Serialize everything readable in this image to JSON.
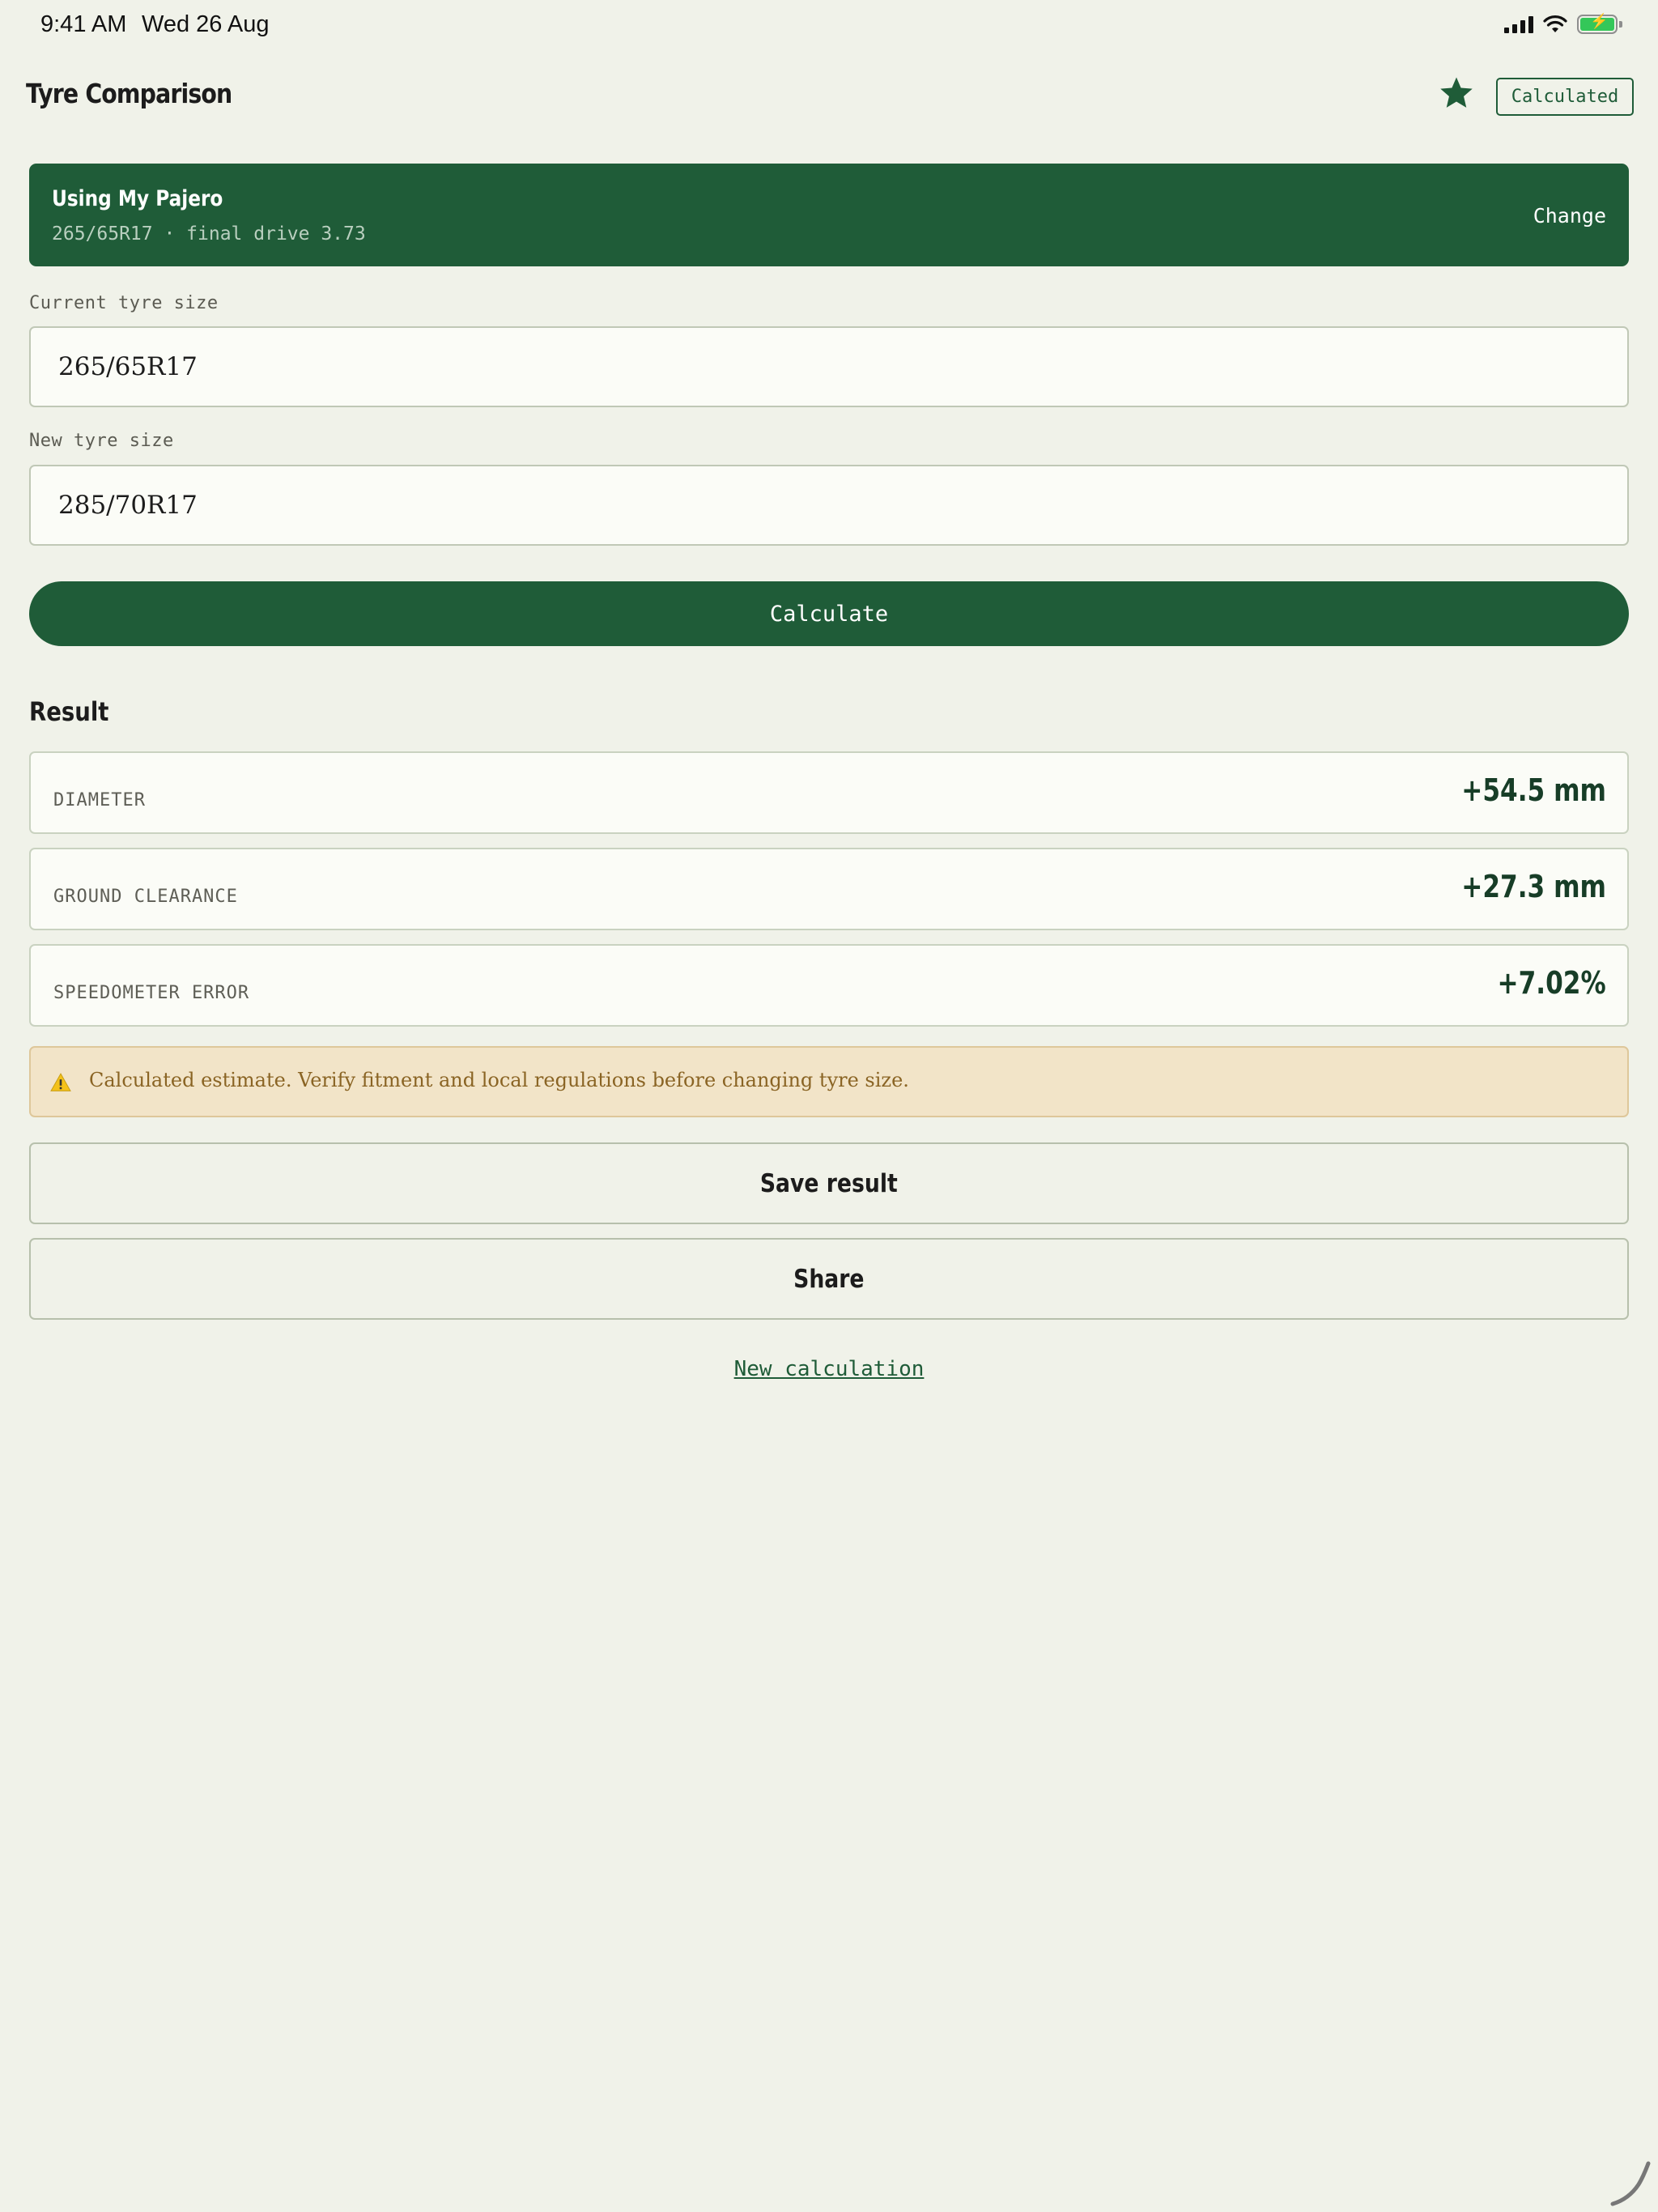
{
  "status_bar": {
    "time": "9:41 AM",
    "date": "Wed 26 Aug",
    "battery_color": "#34c759"
  },
  "header": {
    "title": "Tyre Comparison",
    "favorite_icon": "star-icon",
    "status_badge": "Calculated"
  },
  "vehicle": {
    "title": "Using My Pajero",
    "subtitle": "265/65R17 · final drive 3.73",
    "change_label": "Change"
  },
  "form": {
    "current_label": "Current tyre size",
    "current_value": "265/65R17",
    "new_label": "New tyre size",
    "new_value": "285/70R17",
    "calculate_label": "Calculate"
  },
  "result": {
    "title": "Result",
    "rows": [
      {
        "label": "DIAMETER",
        "value": "+54.5 mm"
      },
      {
        "label": "GROUND CLEARANCE",
        "value": "+27.3 mm"
      },
      {
        "label": "SPEEDOMETER ERROR",
        "value": "+7.02%"
      }
    ],
    "warning": "Calculated estimate. Verify fitment and local regulations before changing tyre size."
  },
  "actions": {
    "save_label": "Save result",
    "share_label": "Share",
    "new_calc_label": "New calculation"
  },
  "colors": {
    "accent": "#1f5c38",
    "background": "#f0f2e9",
    "warning_bg": "#f2e4c8",
    "warning_text": "#8a6424"
  }
}
